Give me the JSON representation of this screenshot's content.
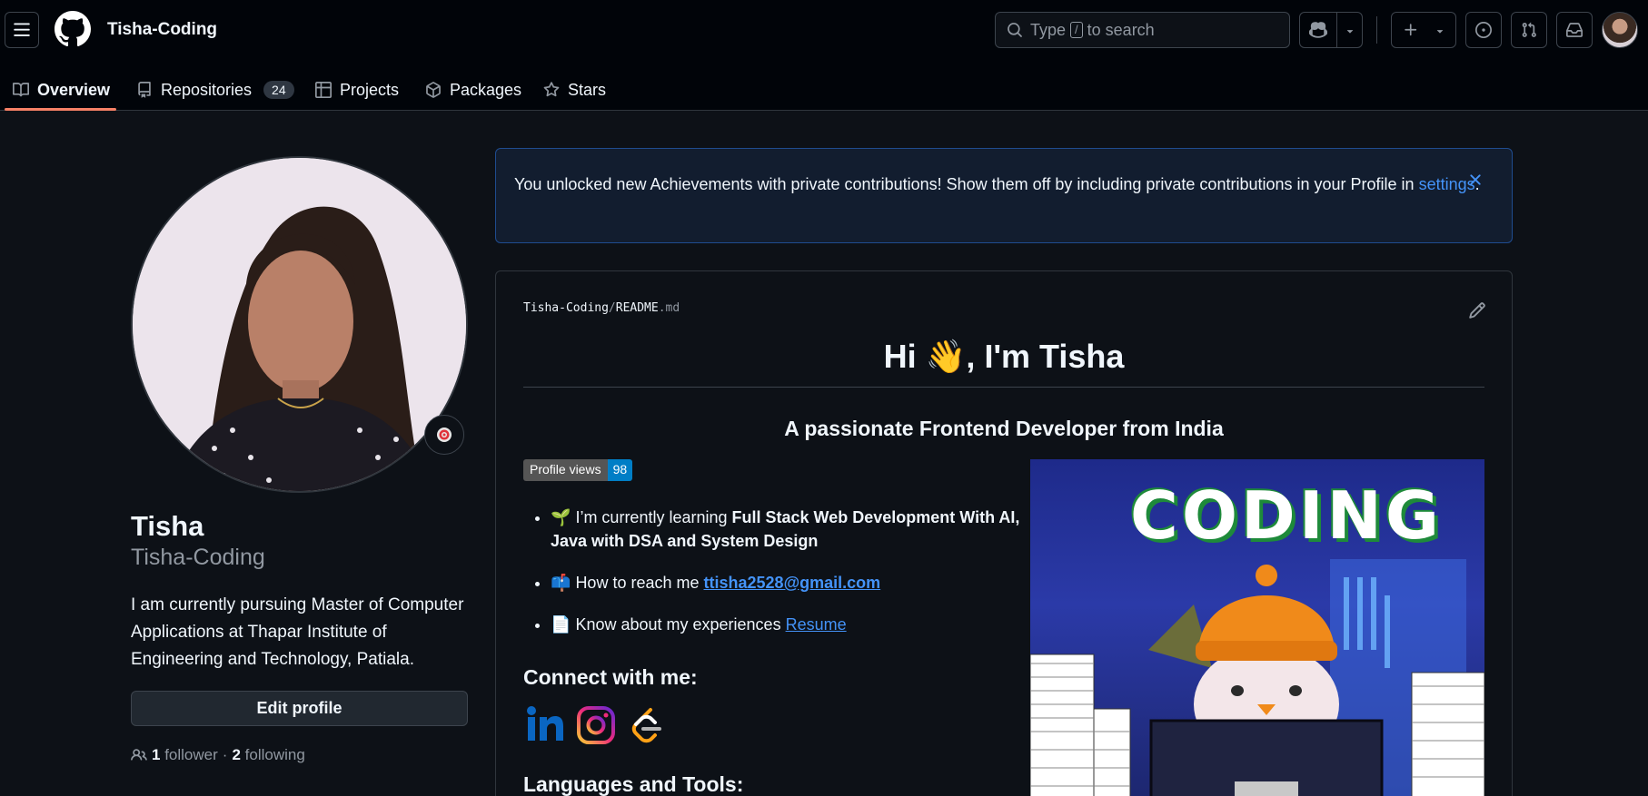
{
  "header": {
    "owner": "Tisha-Coding",
    "search_prefix": "Type",
    "search_key": "/",
    "search_suffix": "to search"
  },
  "tabs": [
    {
      "label": "Overview",
      "icon": "book-icon"
    },
    {
      "label": "Repositories",
      "icon": "repo-icon",
      "count": "24"
    },
    {
      "label": "Projects",
      "icon": "table-icon"
    },
    {
      "label": "Packages",
      "icon": "package-icon"
    },
    {
      "label": "Stars",
      "icon": "star-icon"
    }
  ],
  "profile": {
    "name": "Tisha",
    "login": "Tisha-Coding",
    "bio": "I am currently pursuing Master of Computer Applications at Thapar Institute of Engineering and Technology, Patiala.",
    "edit_label": "Edit profile",
    "followers_count": "1",
    "followers_label": "follower",
    "dot": "·",
    "following_count": "2",
    "following_label": "following"
  },
  "flash": {
    "text": "You unlocked new Achievements with private contributions! Show them off by including private contributions in your Profile in",
    "link": "settings",
    "end": "."
  },
  "readme": {
    "path_owner": "Tisha-Coding",
    "path_sep": "/",
    "path_file": "README",
    "path_ext": ".md",
    "heading": "Hi 👋, I'm Tisha",
    "subheading": "A passionate Frontend Developer from India",
    "badge_label": "Profile views",
    "badge_value": "98",
    "bullet1_emoji": "🌱",
    "bullet1_text": "I’m currently learning",
    "bullet1_bold": "Full Stack Web Development With AI, Java with DSA and System Design",
    "bullet2_emoji": "📫",
    "bullet2_text": "How to reach me",
    "bullet2_link": "ttisha2528@gmail.com",
    "bullet3_emoji": "📄",
    "bullet3_text": "Know about my experiences",
    "bullet3_link": "Resume",
    "connect_heading": "Connect with me:",
    "languages_heading": "Languages and Tools:",
    "gif_text": "CODING"
  },
  "colors": {
    "accent": "#f78166",
    "link": "#4493f8",
    "background": "#0d1117",
    "header_bg": "#010409"
  }
}
